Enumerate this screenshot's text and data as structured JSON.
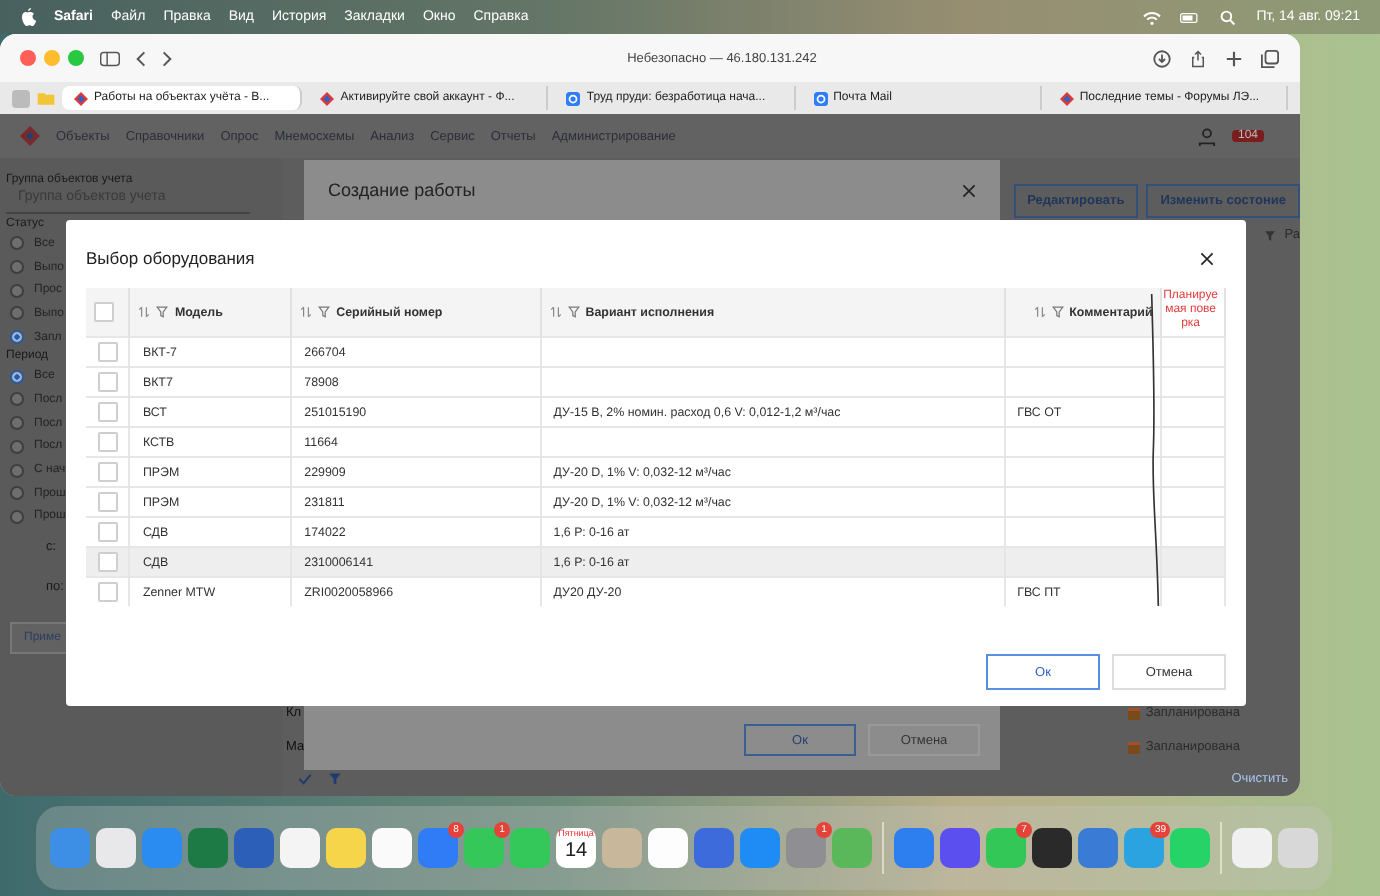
{
  "menu_bar": {
    "app": "Safari",
    "items": [
      "Файл",
      "Правка",
      "Вид",
      "История",
      "Закладки",
      "Окно",
      "Справка"
    ],
    "clock": "Пт, 14 авг.  09:21"
  },
  "browser": {
    "address": "Небезопасно — 46.180.131.242",
    "tabs": [
      {
        "title": "Работы на объектах учёта - В...",
        "kind": "diamond",
        "selected": true
      },
      {
        "title": "Активируйте свой аккаунт - Ф...",
        "kind": "diamond",
        "selected": false
      },
      {
        "title": "Труд пруди: безработица нача...",
        "kind": "square",
        "selected": false
      },
      {
        "title": "Почта Mail",
        "kind": "square",
        "selected": false
      },
      {
        "title": "Последние темы - Форумы ЛЭ...",
        "kind": "diamond",
        "selected": false
      }
    ]
  },
  "app_nav": {
    "items": [
      "Объекты",
      "Справочники",
      "Опрос",
      "Мнемосхемы",
      "Анализ",
      "Сервис",
      "Отчеты",
      "Администрирование"
    ],
    "badge": "104"
  },
  "sidebar": {
    "group_label": "Группа объектов учета",
    "group_placeholder": "Группа объектов учета",
    "status_label": "Статус",
    "status_options": [
      {
        "label": "Все",
        "selected": false
      },
      {
        "label": "Выпо",
        "selected": false
      },
      {
        "label": "Прос",
        "selected": false
      },
      {
        "label": "Выпо",
        "selected": false
      },
      {
        "label": "Запл",
        "selected": true
      }
    ],
    "period_label": "Период",
    "period_options": [
      {
        "label": "Все",
        "selected": true
      },
      {
        "label": "Посл",
        "selected": false
      },
      {
        "label": "Посл",
        "selected": false
      },
      {
        "label": "Посл",
        "selected": false
      },
      {
        "label": "С нач",
        "selected": false
      },
      {
        "label": "Прош",
        "selected": false
      },
      {
        "label": "Прош",
        "selected": false
      }
    ],
    "from_label": "с:",
    "to_label": "по:",
    "apply_button": "Приме"
  },
  "page": {
    "buttons": [
      "Редактировать",
      "Изменить состоние"
    ],
    "filter_text": "Ра",
    "rows": [
      {
        "label": "Кл",
        "status": "Запланирована"
      },
      {
        "label": "Ма",
        "status": "Запланирована"
      }
    ],
    "clear_link": "Очистить"
  },
  "create_dialog": {
    "title": "Создание работы",
    "ok": "Ок",
    "cancel": "Отмена"
  },
  "equipment_dialog": {
    "title": "Выбор оборудования",
    "all_checked": false,
    "columns": [
      "Модель",
      "Серийный номер",
      "Вариант исполнения",
      "Комментарий"
    ],
    "rows": [
      {
        "model": "ВКТ-7",
        "serial": "266704",
        "variant": "",
        "comment": "",
        "checked": false,
        "highlighted": false
      },
      {
        "model": "ВКТ7",
        "serial": "78908",
        "variant": "",
        "comment": "",
        "checked": false,
        "highlighted": false
      },
      {
        "model": "ВСТ",
        "serial": "251015190",
        "variant": "ДУ-15 В, 2% номин. расход 0,6 V: 0,012-1,2 м³/час",
        "comment": "ГВС ОТ",
        "checked": false,
        "highlighted": false
      },
      {
        "model": "КСТВ",
        "serial": "11664",
        "variant": "",
        "comment": "",
        "checked": false,
        "highlighted": false
      },
      {
        "model": "ПРЭМ",
        "serial": "229909",
        "variant": "ДУ-20 D, 1% V: 0,032-12 м³/час",
        "comment": "",
        "checked": false,
        "highlighted": false
      },
      {
        "model": "ПРЭМ",
        "serial": "231811",
        "variant": "ДУ-20 D, 1% V: 0,032-12 м³/час",
        "comment": "",
        "checked": false,
        "highlighted": false
      },
      {
        "model": "СДВ",
        "serial": "174022",
        "variant": "1,6 Р: 0-16 ат",
        "comment": "",
        "checked": false,
        "highlighted": false
      },
      {
        "model": "СДВ",
        "serial": "2310006141",
        "variant": "1,6 Р: 0-16 ат",
        "comment": "",
        "checked": false,
        "highlighted": true
      },
      {
        "model": "Zenner MTW",
        "serial": "ZRI0020058966",
        "variant": "ДУ20 ДУ-20",
        "comment": "ГВС ПТ",
        "checked": false,
        "highlighted": false
      }
    ],
    "annotation": "Планируемая поверка",
    "ok": "Ок",
    "cancel": "Отмена"
  },
  "dock": [
    {
      "kind": "app",
      "color": "#3d8fe6"
    },
    {
      "kind": "app",
      "color": "#e8e8ea"
    },
    {
      "kind": "app",
      "color": "#2a8cf0"
    },
    {
      "kind": "app",
      "color": "#1e7a45"
    },
    {
      "kind": "app",
      "color": "#2b5fb8"
    },
    {
      "kind": "app",
      "color": "#f4f4f4"
    },
    {
      "kind": "app",
      "color": "#f7d54a"
    },
    {
      "kind": "app",
      "color": "#fafafa"
    },
    {
      "kind": "app",
      "color": "#2f7cf6",
      "badge": "8"
    },
    {
      "kind": "app",
      "color": "#35c759",
      "badge": "1"
    },
    {
      "kind": "app",
      "color": "#34c759"
    },
    {
      "kind": "calendar",
      "color": "#ffffff",
      "day_name": "Пятница",
      "day": "14"
    },
    {
      "kind": "app",
      "color": "#c9b79c"
    },
    {
      "kind": "app",
      "color": "#fdfdfd"
    },
    {
      "kind": "app",
      "color": "#3d6bdc"
    },
    {
      "kind": "app",
      "color": "#1f8cf5"
    },
    {
      "kind": "app",
      "color": "#8e8e93",
      "badge": "1"
    },
    {
      "kind": "app",
      "color": "#5bb85a"
    },
    {
      "kind": "separator"
    },
    {
      "kind": "app",
      "color": "#2d7ff0"
    },
    {
      "kind": "app",
      "color": "#5b4ff0"
    },
    {
      "kind": "app",
      "color": "#33c758",
      "badge": "7"
    },
    {
      "kind": "app",
      "color": "#2a2a2a"
    },
    {
      "kind": "app",
      "color": "#3a7bd5"
    },
    {
      "kind": "app",
      "color": "#2aa3e0",
      "badge": "39"
    },
    {
      "kind": "app",
      "color": "#25d366"
    },
    {
      "kind": "separator"
    },
    {
      "kind": "app",
      "color": "#f0f0f0"
    },
    {
      "kind": "app",
      "color": "#d8d8d8"
    }
  ]
}
